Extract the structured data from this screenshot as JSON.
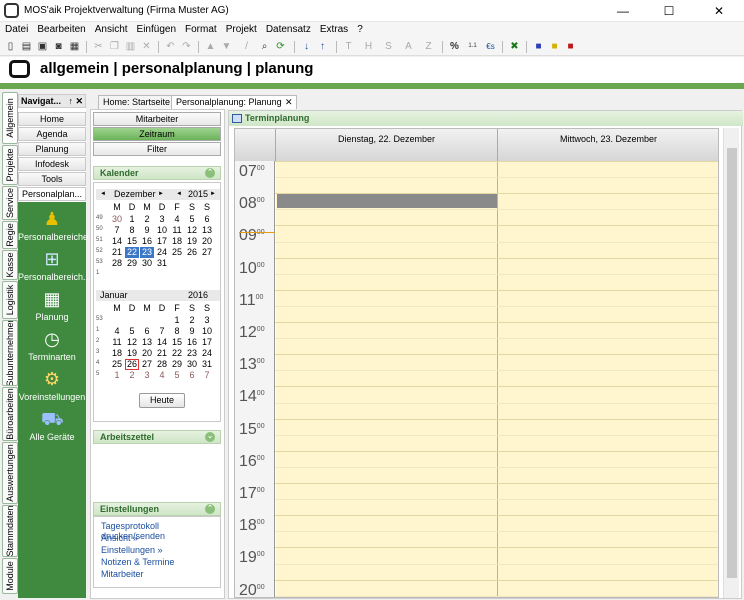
{
  "window": {
    "title": "MOS'aik Projektverwaltung (Firma Muster AG)",
    "controls": [
      "—",
      "☐",
      "✕"
    ]
  },
  "menu": [
    "Datei",
    "Bearbeiten",
    "Ansicht",
    "Einfügen",
    "Format",
    "Projekt",
    "Datensatz",
    "Extras",
    "?"
  ],
  "toolbar_text": {
    "t": "T",
    "h": "H",
    "s": "S",
    "a": "A",
    "z": "Z",
    "pct": "%",
    "eu": "€s"
  },
  "header": {
    "breadcrumb": "allgemein | personalplanung | planung"
  },
  "vertical_tabs": [
    "Allgemein",
    "Projekte",
    "Service",
    "Regie",
    "Kasse",
    "Logistik",
    "Subunternehmer",
    "Büroarbeiten",
    "Auswertungen",
    "Stammdaten",
    "Module"
  ],
  "nav": {
    "title": "Navigat...",
    "pin": "↑",
    "close": "✕",
    "buttons": [
      "Home",
      "Agenda",
      "Planung",
      "Infodesk",
      "Tools",
      "Personalplan..."
    ],
    "items": [
      "Personalbereiche",
      "Personalbereich...",
      "Planung",
      "Terminarten",
      "Voreinstellungen",
      "Alle Geräte"
    ]
  },
  "doc_tabs": [
    "Home: Startseite",
    "Personalplanung: Planung"
  ],
  "views": [
    "Mitarbeiter",
    "Zeitraum",
    "Filter"
  ],
  "kalender": {
    "label": "Kalender",
    "dow": [
      "M",
      "D",
      "M",
      "D",
      "F",
      "S",
      "S"
    ],
    "month1": {
      "name": "Dezember",
      "year": "2015",
      "prev": "◄",
      "next": "►",
      "weeks": [
        {
          "wk": "49",
          "days": [
            "30",
            "1",
            "2",
            "3",
            "4",
            "5",
            "6"
          ]
        },
        {
          "wk": "50",
          "days": [
            "7",
            "8",
            "9",
            "10",
            "11",
            "12",
            "13"
          ]
        },
        {
          "wk": "51",
          "days": [
            "14",
            "15",
            "16",
            "17",
            "18",
            "19",
            "20"
          ]
        },
        {
          "wk": "52",
          "days": [
            "21",
            "22",
            "23",
            "24",
            "25",
            "26",
            "27"
          ]
        },
        {
          "wk": "53",
          "days": [
            "28",
            "29",
            "30",
            "31",
            "",
            "",
            ""
          ]
        },
        {
          "wk": "1",
          "days": [
            "",
            "",
            "",
            "",
            "",
            "",
            ""
          ]
        }
      ]
    },
    "month2": {
      "name": "Januar",
      "year": "2016",
      "weeks": [
        {
          "wk": "53",
          "days": [
            "",
            "",
            "",
            "",
            "1",
            "2",
            "3"
          ]
        },
        {
          "wk": "1",
          "days": [
            "4",
            "5",
            "6",
            "7",
            "8",
            "9",
            "10"
          ]
        },
        {
          "wk": "2",
          "days": [
            "11",
            "12",
            "13",
            "14",
            "15",
            "16",
            "17"
          ]
        },
        {
          "wk": "3",
          "days": [
            "18",
            "19",
            "20",
            "21",
            "22",
            "23",
            "24"
          ]
        },
        {
          "wk": "4",
          "days": [
            "25",
            "26",
            "27",
            "28",
            "29",
            "30",
            "31"
          ]
        },
        {
          "wk": "5",
          "days": [
            "1",
            "2",
            "3",
            "4",
            "5",
            "6",
            "7"
          ]
        }
      ]
    },
    "today_button": "Heute"
  },
  "arbeitszettel": {
    "label": "Arbeitszettel"
  },
  "einstellungen": {
    "label": "Einstellungen",
    "links": [
      "Tagesprotokoll drucken/senden",
      "Ansicht »",
      "Einstellungen »",
      "Notizen & Termine",
      "Mitarbeiter"
    ]
  },
  "schedule": {
    "title": "Terminplanung",
    "days": [
      "Dienstag, 22. Dezember",
      "Mittwoch, 23. Dezember"
    ],
    "hours": [
      "07",
      "08",
      "09",
      "10",
      "11",
      "12",
      "13",
      "14",
      "15",
      "16",
      "17",
      "18",
      "19",
      "20"
    ],
    "minutes": "00"
  },
  "colors": {
    "accent_green": "#6aa84f",
    "slot_yellow": "#fff6cf",
    "selected_blue": "#3b77c7",
    "busy_gray": "#8a8a8a"
  }
}
